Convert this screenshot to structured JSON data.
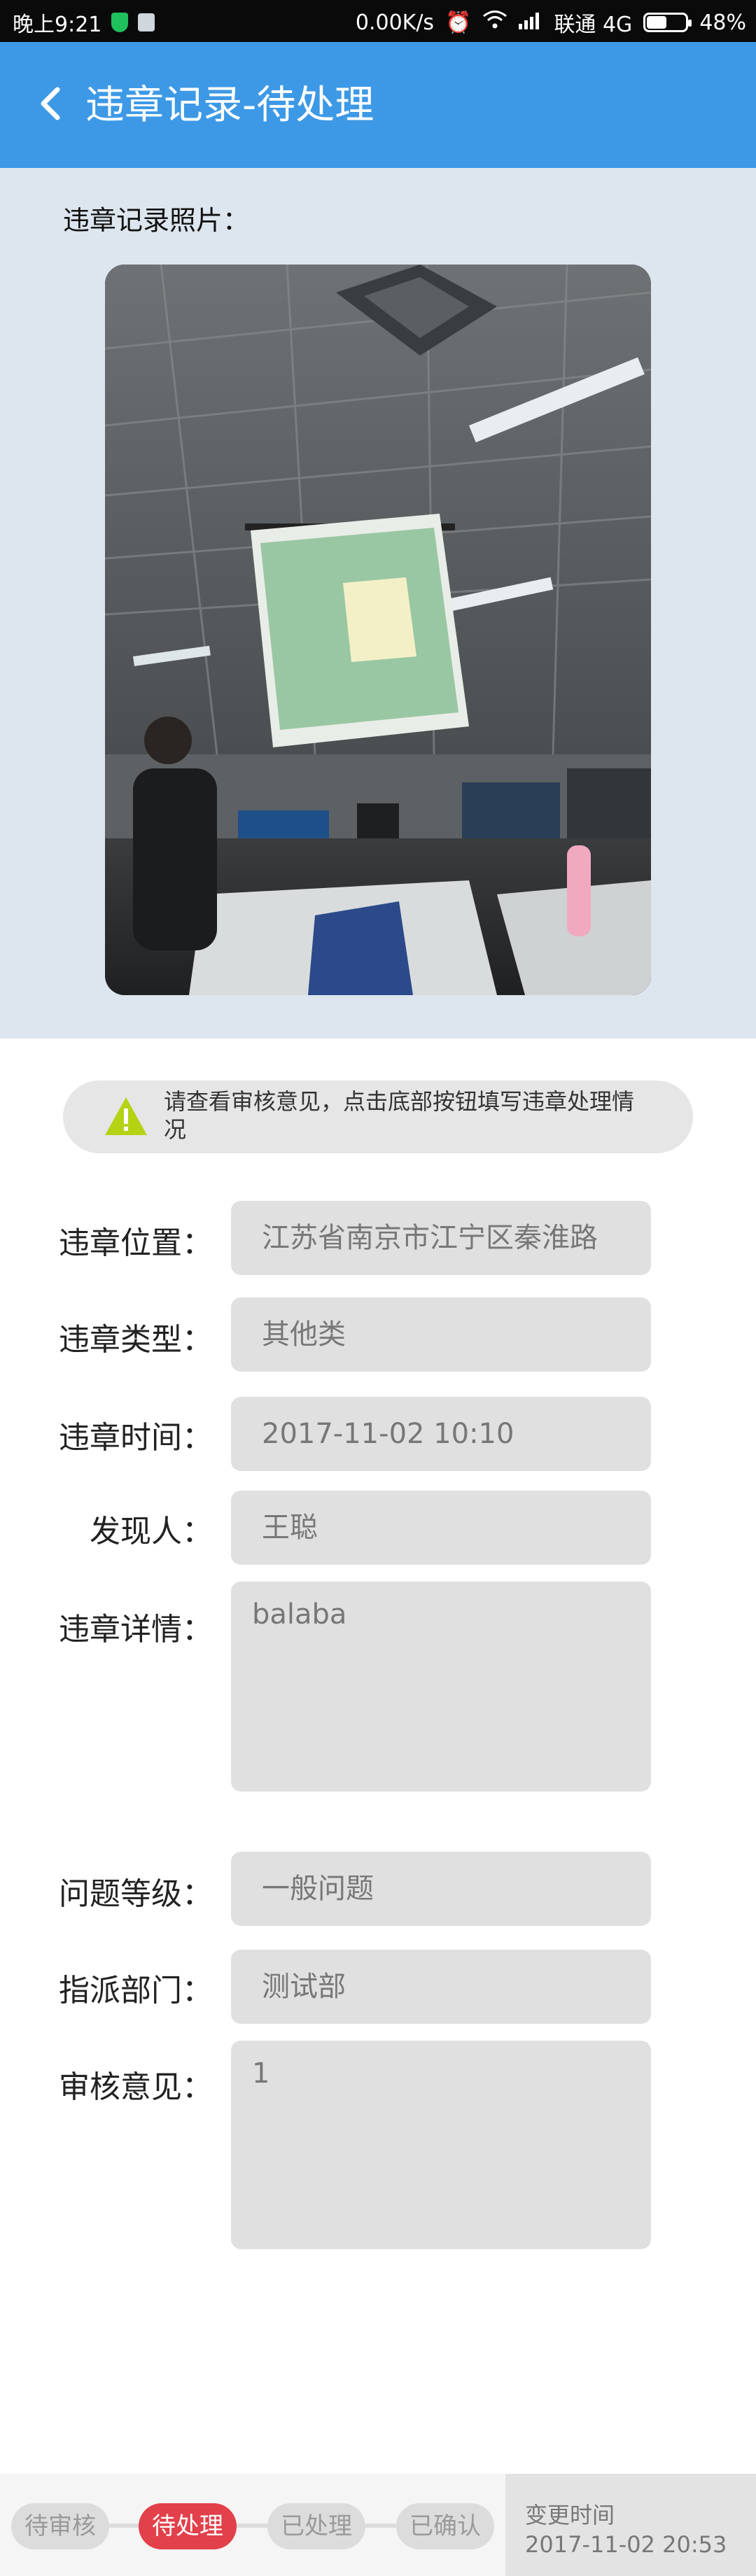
{
  "status_bar": {
    "time": "晚上9:21",
    "network_speed": "0.00K/s",
    "carrier": "联通 4G",
    "battery": "48%"
  },
  "app_bar": {
    "title": "违章记录-待处理"
  },
  "photo_section": {
    "label": "违章记录照片："
  },
  "notice": {
    "text": "请查看审核意见，点击底部按钮填写违章处理情况"
  },
  "form": {
    "location": {
      "label": "违章位置：",
      "value": "江苏省南京市江宁区秦淮路"
    },
    "type": {
      "label": "违章类型：",
      "value": "其他类"
    },
    "time": {
      "label": "违章时间：",
      "value": "2017-11-02 10:10"
    },
    "finder": {
      "label": "发现人：",
      "value": "王聪"
    },
    "details": {
      "label": "违章详情：",
      "value": "balaba"
    },
    "level": {
      "label": "问题等级：",
      "value": "一般问题"
    },
    "department": {
      "label": "指派部门：",
      "value": "测试部"
    },
    "review": {
      "label": "审核意见：",
      "value": "1"
    }
  },
  "bottom_bar": {
    "steps": [
      {
        "label": "待审核"
      },
      {
        "label": "待处理"
      },
      {
        "label": "已处理"
      },
      {
        "label": "已确认"
      }
    ],
    "change_time_label": "变更时间",
    "change_time_value": "2017-11-02 20:53"
  },
  "colors": {
    "app_bar": "#3d99e6",
    "active_step": "#e2404a",
    "warning_icon": "#b5d214"
  }
}
